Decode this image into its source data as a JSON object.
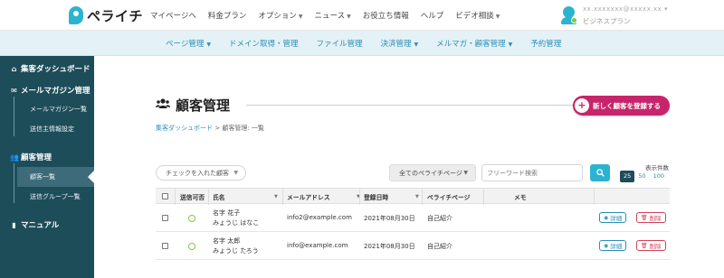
{
  "app": {
    "name": "ペライチ"
  },
  "topnav": [
    {
      "label": "マイページへ",
      "dropdown": false
    },
    {
      "label": "料金プラン",
      "dropdown": false
    },
    {
      "label": "オプション",
      "dropdown": true
    },
    {
      "label": "ニュース",
      "dropdown": true
    },
    {
      "label": "お役立ち情報",
      "dropdown": false
    },
    {
      "label": "ヘルプ",
      "dropdown": false
    },
    {
      "label": "ビデオ相談",
      "dropdown": true
    }
  ],
  "user": {
    "email": "xx.xxxxxxx@xxxxx.xx ▾",
    "plan": "ビジネスプラン"
  },
  "subnav": [
    {
      "label": "ページ管理",
      "dropdown": true
    },
    {
      "label": "ドメイン取得・管理",
      "dropdown": false
    },
    {
      "label": "ファイル管理",
      "dropdown": false
    },
    {
      "label": "決済管理",
      "dropdown": true
    },
    {
      "label": "メルマガ・顧客管理",
      "dropdown": true
    },
    {
      "label": "予約管理",
      "dropdown": false
    }
  ],
  "sidebar": {
    "dashboard": "集客ダッシュボード",
    "mail_magazine": "メールマガジン管理",
    "mail_items": [
      "メールマガジン一覧",
      "送信主情報設定"
    ],
    "customers": "顧客管理",
    "customer_items": [
      "顧客一覧",
      "送信グループ一覧"
    ],
    "manual": "マニュアル"
  },
  "page": {
    "title": "顧客管理",
    "add_button": "新しく顧客を登録する",
    "breadcrumb_link": "集客ダッシュボード",
    "breadcrumb_sep": ">",
    "breadcrumb_current": "顧客管理: 一覧"
  },
  "filters": {
    "checked_select": "チェックを入れた顧客",
    "peraichi_select": "全てのペライチページ",
    "search_placeholder": "フリーワード検索",
    "perpage_label": "表示件数",
    "perpage_options": [
      "25",
      "50",
      "100"
    ],
    "perpage_selected": "25"
  },
  "table": {
    "headers": [
      "送信可否",
      "氏名",
      "メールアドレス",
      "登録日時",
      "ペライチページ",
      "メモ"
    ],
    "rows": [
      {
        "name": "名字 花子",
        "kana": "みょうじ はなこ",
        "email": "info2@example.com",
        "date": "2021年08月30日",
        "page": "自己紹介",
        "memo": ""
      },
      {
        "name": "名字 太郎",
        "kana": "みょうじ たろう",
        "email": "info@example.com",
        "date": "2021年08月30日",
        "page": "自己紹介",
        "memo": ""
      }
    ],
    "detail_label": "詳細",
    "delete_label": "削除"
  },
  "colors": {
    "brand": "#2bb3d0",
    "sidebar": "#1e4d5a",
    "add_button": "#c7256b",
    "status_ok": "#8cc63f",
    "delete": "#d0425a"
  },
  "icons": {
    "dashboard": "home-icon",
    "mail": "envelope-icon",
    "customers": "users-icon",
    "manual": "book-icon",
    "search": "search-icon",
    "detail": "eye-icon",
    "delete": "trash-icon",
    "add": "plus-icon"
  }
}
